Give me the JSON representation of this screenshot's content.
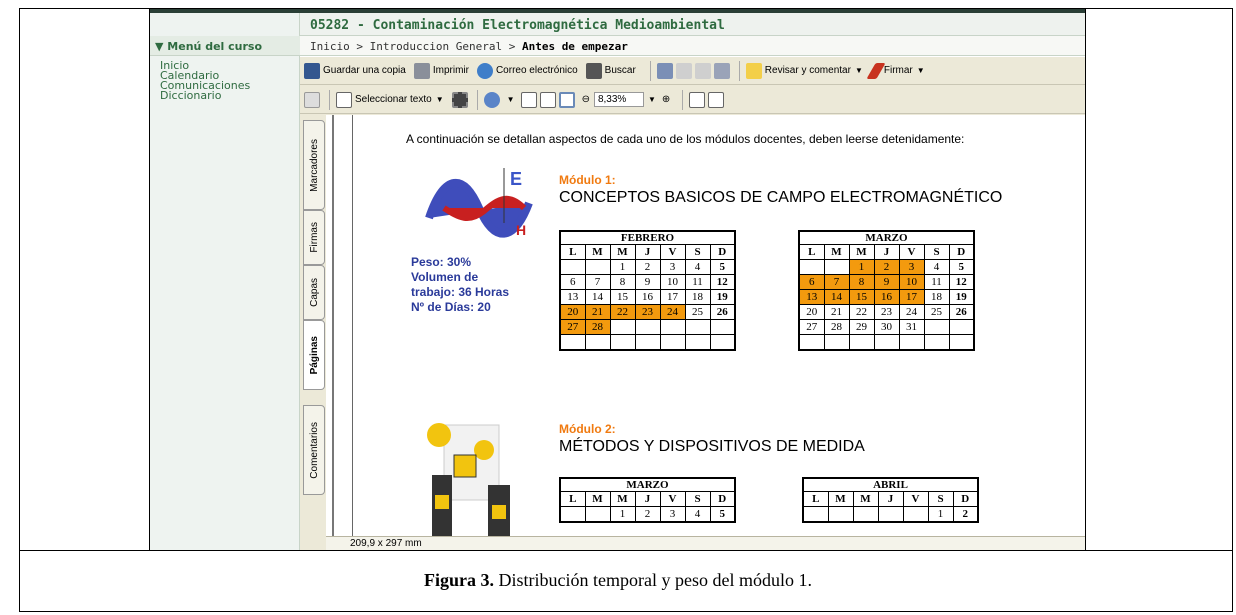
{
  "header": {
    "course_title": "05282 - Contaminación Electromagnética Medioambiental"
  },
  "sidebar": {
    "title": "Menú del curso",
    "items": [
      "Inicio",
      "Calendario",
      "Comunicaciones",
      "Diccionario"
    ]
  },
  "breadcrumb": {
    "items": [
      "Inicio",
      "Introduccion General"
    ],
    "current": "Antes de empezar",
    "separator": ">"
  },
  "toolbar1": {
    "save": "Guardar una copia",
    "print": "Imprimir",
    "email": "Correo electrónico",
    "search": "Buscar",
    "review": "Revisar y comentar",
    "sign": "Firmar"
  },
  "toolbar2": {
    "select_text": "Seleccionar texto",
    "zoom": "8,33%"
  },
  "side_tabs": [
    "Marcadores",
    "Firmas",
    "Capas",
    "Páginas",
    "Comentarios"
  ],
  "status": {
    "page_size": "209,9 x 297 mm"
  },
  "document": {
    "intro": "A continuación se detallan aspectos de cada uno de los módulos docentes, deben leerse detenidamente:",
    "module1": {
      "label": "Módulo 1:",
      "title": "CONCEPTOS BASICOS DE CAMPO ELECTROMAGNÉTICO",
      "stats": [
        "Peso: 30%",
        "Volumen de",
        "trabajo: 36 Horas",
        "Nº de Días: 20"
      ],
      "wave_labels": [
        "E",
        "H"
      ]
    },
    "module2": {
      "label": "Módulo 2:",
      "title": "MÉTODOS Y DISPOSITIVOS DE MEDIDA"
    },
    "days": [
      "L",
      "M",
      "M",
      "J",
      "V",
      "S",
      "D"
    ],
    "calendars": [
      {
        "month": "FEBRERO",
        "rows": [
          [
            "",
            "",
            "1",
            "2",
            "3",
            "4",
            "5"
          ],
          [
            "6",
            "7",
            "8",
            "9",
            "10",
            "11",
            "12"
          ],
          [
            "13",
            "14",
            "15",
            "16",
            "17",
            "18",
            "19"
          ],
          [
            "20",
            "21",
            "22",
            "23",
            "24",
            "25",
            "26"
          ],
          [
            "27",
            "28",
            "",
            "",
            "",
            "",
            ""
          ],
          [
            "",
            "",
            "",
            "",
            "",
            "",
            ""
          ]
        ],
        "highlight": [
          "20",
          "21",
          "22",
          "23",
          "24",
          "27",
          "28"
        ]
      },
      {
        "month": "MARZO",
        "rows": [
          [
            "",
            "",
            "1",
            "2",
            "3",
            "4",
            "5"
          ],
          [
            "6",
            "7",
            "8",
            "9",
            "10",
            "11",
            "12"
          ],
          [
            "13",
            "14",
            "15",
            "16",
            "17",
            "18",
            "19"
          ],
          [
            "20",
            "21",
            "22",
            "23",
            "24",
            "25",
            "26"
          ],
          [
            "27",
            "28",
            "29",
            "30",
            "31",
            "",
            ""
          ],
          [
            "",
            "",
            "",
            "",
            "",
            "",
            ""
          ]
        ],
        "highlight": [
          "1",
          "2",
          "3",
          "6",
          "7",
          "8",
          "9",
          "10",
          "13",
          "14",
          "15",
          "16",
          "17"
        ]
      },
      {
        "month": "MARZO",
        "rows": [
          [
            "",
            "",
            "1",
            "2",
            "3",
            "4",
            "5"
          ]
        ],
        "highlight": []
      },
      {
        "month": "ABRIL",
        "rows": [
          [
            "",
            "",
            "",
            "",
            "",
            "1",
            "2"
          ]
        ],
        "highlight": []
      }
    ]
  },
  "colors": {
    "highlight": "#f39a0e",
    "module_label": "#f07a10",
    "stats_text": "#2a3a9a",
    "menu_text": "#2f6b40"
  },
  "caption": {
    "label": "Figura 3.",
    "text": "Distribución temporal y peso del módulo 1."
  }
}
